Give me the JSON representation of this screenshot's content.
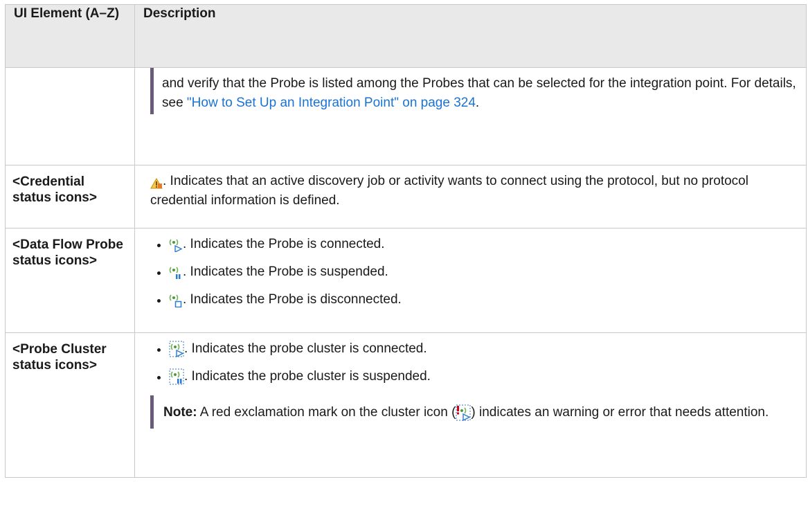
{
  "table": {
    "headers": {
      "col1": "UI Element (A–Z)",
      "col2": "Description"
    },
    "rows": {
      "r0": {
        "element": "",
        "text_before": "and verify that the Probe is listed among the Probes that can be selected for the integration point. For details, see ",
        "link": "\"How to Set Up an Integration Point\" on page 324",
        "text_after": "."
      },
      "r1": {
        "element": "<Credential status icons>",
        "icon": "credential-warning-icon",
        "text": ". Indicates that an active discovery job or activity wants to connect using the protocol, but no protocol credential information is defined."
      },
      "r2": {
        "element": "<Data Flow Probe status icons>",
        "items": [
          {
            "icon": "probe-connected-icon",
            "text": ". Indicates the Probe is connected."
          },
          {
            "icon": "probe-suspended-icon",
            "text": ". Indicates the Probe is suspended."
          },
          {
            "icon": "probe-disconnected-icon",
            "text": ". Indicates the Probe is disconnected."
          }
        ]
      },
      "r3": {
        "element": "<Probe Cluster status icons>",
        "items": [
          {
            "icon": "cluster-connected-icon",
            "text": ". Indicates the probe cluster is connected."
          },
          {
            "icon": "cluster-suspended-icon",
            "text": ". Indicates the probe cluster is suspended."
          }
        ],
        "note": {
          "label": "Note:",
          "text_before": " A red exclamation mark on the cluster icon (",
          "icon": "cluster-warning-icon",
          "text_after": ") indicates an warning or error that needs attention."
        }
      }
    }
  },
  "colors": {
    "header_bg": "#e9e9e9",
    "note_bar": "#6b5b7b",
    "link": "#1a73d4"
  }
}
